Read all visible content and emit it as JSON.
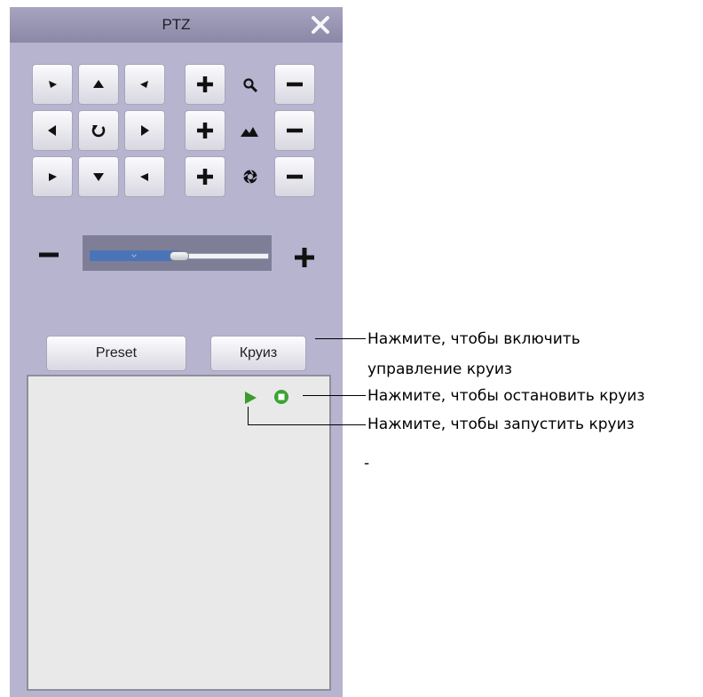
{
  "window": {
    "title": "PTZ"
  },
  "ptz": {
    "direction_buttons": [
      {
        "name": "pan-up-left-button",
        "icon": "arrow-up-left-icon"
      },
      {
        "name": "pan-up-button",
        "icon": "arrow-up-icon"
      },
      {
        "name": "pan-up-right-button",
        "icon": "arrow-up-right-icon"
      },
      {
        "name": "pan-left-button",
        "icon": "arrow-left-icon"
      },
      {
        "name": "auto-rotate-button",
        "icon": "rotate-icon"
      },
      {
        "name": "pan-right-button",
        "icon": "arrow-right-icon"
      },
      {
        "name": "pan-down-left-button",
        "icon": "arrow-down-left-icon"
      },
      {
        "name": "pan-down-button",
        "icon": "arrow-down-icon"
      },
      {
        "name": "pan-down-right-button",
        "icon": "arrow-down-right-icon"
      }
    ],
    "lens_rows": [
      {
        "name": "zoom",
        "icon": "magnifier-icon"
      },
      {
        "name": "focus",
        "icon": "mountain-icon"
      },
      {
        "name": "iris",
        "icon": "aperture-icon"
      }
    ],
    "speed_slider": {
      "value": 0.5,
      "minus_icon": "minus-icon",
      "plus_icon": "plus-icon"
    }
  },
  "tabs": {
    "preset_label": "Preset",
    "cruise_label": "Круиз"
  },
  "cruise_controls": {
    "play_icon": "play-icon",
    "stop_icon": "stop-icon",
    "play_color": "#3a9c2a",
    "stop_color": "#3aa331"
  },
  "annotations": {
    "cruise_tab_note_line1": "Нажмите, чтобы включить",
    "cruise_tab_note_line2": "управление круиз",
    "stop_note": "Нажмите, чтобы остановить круиз",
    "play_note": "Нажмите, чтобы запустить круиз",
    "stray_mark": "-"
  },
  "colors": {
    "panel_bg": "#b6b4cf",
    "titlebar": "#9896b4",
    "slider_fill": "#4a74b8"
  }
}
